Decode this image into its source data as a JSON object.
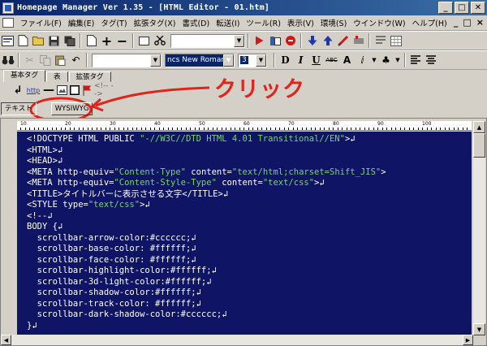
{
  "window": {
    "title": "Homepage Manager Ver 1.35 - [HTML Editor - 01.htm]",
    "buttons": [
      "_",
      "□",
      "✕"
    ]
  },
  "menubar": {
    "items": [
      "ファイル(F)",
      "編集(E)",
      "タグ(T)",
      "拡張タグ(X)",
      "書式(D)",
      "転送(I)",
      "ツール(R)",
      "表示(V)",
      "環境(S)",
      "ウインドウ(W)",
      "ヘルプ(H)"
    ],
    "right_controls": [
      "_",
      "□",
      "×"
    ]
  },
  "toolbar1": {
    "dropdown_value": ""
  },
  "toolbar2": {
    "style_combo": "",
    "font_combo": "ncs New Roman",
    "size_combo": "3"
  },
  "tabs": {
    "items": [
      "基本タグ",
      "表",
      "拡張タグ"
    ]
  },
  "tagbar": {
    "link_label": "http"
  },
  "annotation": {
    "text": "クリック",
    "color": "#e0241b"
  },
  "modebar": {
    "text_label": "テキスト",
    "wysiwyg_label": "WYSIWYG"
  },
  "ruler": {
    "labels": [
      "10",
      "20",
      "30",
      "40",
      "50",
      "60",
      "70",
      "80",
      "90",
      "100"
    ]
  },
  "editor": {
    "background": "#0f1564",
    "lines": [
      [
        [
          "<!DOCTYPE HTML PUBLIC ",
          "tag"
        ],
        [
          "\"-//W3C//DTD HTML 4.01 Transitional//EN\"",
          "str"
        ],
        [
          ">↲",
          "tag"
        ]
      ],
      [
        [
          "<HTML>↲",
          "tag"
        ]
      ],
      [
        [
          "<HEAD>↲",
          "tag"
        ]
      ],
      [
        [
          "<META http-equiv=",
          "tag"
        ],
        [
          "\"Content-Type\"",
          "str"
        ],
        [
          " content=",
          "tag"
        ],
        [
          "\"text/html;charset=Shift_JIS\"",
          "str"
        ],
        [
          ">",
          "tag"
        ]
      ],
      [
        [
          "<META http-equiv=",
          "tag"
        ],
        [
          "\"Content-Style-Type\"",
          "str"
        ],
        [
          " content=",
          "tag"
        ],
        [
          "\"text/css\"",
          "str"
        ],
        [
          ">↲",
          "tag"
        ]
      ],
      [
        [
          "<TITLE>タイトルバーに表示させる文字</TITLE>↲",
          "tag"
        ]
      ],
      [
        [
          "<STYLE type=",
          "tag"
        ],
        [
          "\"text/css\"",
          "str"
        ],
        [
          ">↲",
          "tag"
        ]
      ],
      [
        [
          "<!--↲",
          "tag"
        ]
      ],
      [
        [
          "BODY {↲",
          "css"
        ]
      ],
      [
        [
          "  scrollbar-arrow-color:#cccccc;↲",
          "css"
        ]
      ],
      [
        [
          "  scrollbar-base-color: #ffffff;↲",
          "css"
        ]
      ],
      [
        [
          "  scrollbar-face-color: #ffffff;↲",
          "css"
        ]
      ],
      [
        [
          "  scrollbar-highlight-color:#ffffff;↲",
          "css"
        ]
      ],
      [
        [
          "  scrollbar-3d-light-color:#ffffff;↲",
          "css"
        ]
      ],
      [
        [
          "  scrollbar-shadow-color:#ffffff;↲",
          "css"
        ]
      ],
      [
        [
          "  scrollbar-track-color: #ffffff;↲",
          "css"
        ]
      ],
      [
        [
          "  scrollbar-dark-shadow-color:#cccccc;↲",
          "css"
        ]
      ],
      [
        [
          "}↲",
          "css"
        ]
      ]
    ]
  }
}
